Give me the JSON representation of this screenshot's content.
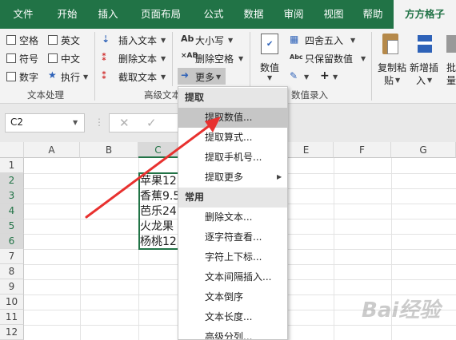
{
  "tabs": [
    "文件",
    "开始",
    "插入",
    "页面布局",
    "公式",
    "数据",
    "审阅",
    "视图",
    "帮助",
    "方方格子"
  ],
  "ribbon": {
    "text_group": {
      "checkboxes": [
        "空格",
        "英文",
        "符号",
        "中文",
        "数字"
      ],
      "execute": "执行",
      "label": "文本处理"
    },
    "advanced_group": {
      "insert_text": "插入文本",
      "delete_text": "删除文本",
      "cut_text": "截取文本",
      "case": "大小写",
      "delete_space": "删除空格",
      "more": "更多",
      "label": "高级文本"
    },
    "number_group": {
      "value": "数值",
      "round": "四舍五入",
      "keep_value": "只保留数值",
      "label": "数值录入"
    },
    "paste_group": {
      "copy_paste_1": "复制粘",
      "copy_paste_2": "贴",
      "new_insert_1": "新增插",
      "new_insert_2": "入",
      "batch_1": "批",
      "batch_2": "量"
    }
  },
  "formula_bar": {
    "name_box": "C2"
  },
  "sheet": {
    "columns": [
      "A",
      "B",
      "C",
      "D",
      "E",
      "F",
      "G"
    ],
    "rows": [
      "1",
      "2",
      "3",
      "4",
      "5",
      "6",
      "7",
      "8",
      "9",
      "10",
      "11",
      "12"
    ],
    "cells": [
      "苹果12",
      "香蕉9.5",
      "芭乐24",
      "火龙果",
      "杨桃12"
    ]
  },
  "menu": {
    "header1": "提取",
    "items1": [
      "提取数值...",
      "提取算式...",
      "提取手机号...",
      "提取更多"
    ],
    "header2": "常用",
    "items2": [
      "删除文本...",
      "逐字符查看...",
      "字符上下标...",
      "文本间隔插入...",
      "文本倒序",
      "文本长度...",
      "高级分列..."
    ]
  },
  "watermark": "Bai经验",
  "colors": {
    "excel_green": "#217346",
    "arrow_red": "#e8312f"
  }
}
